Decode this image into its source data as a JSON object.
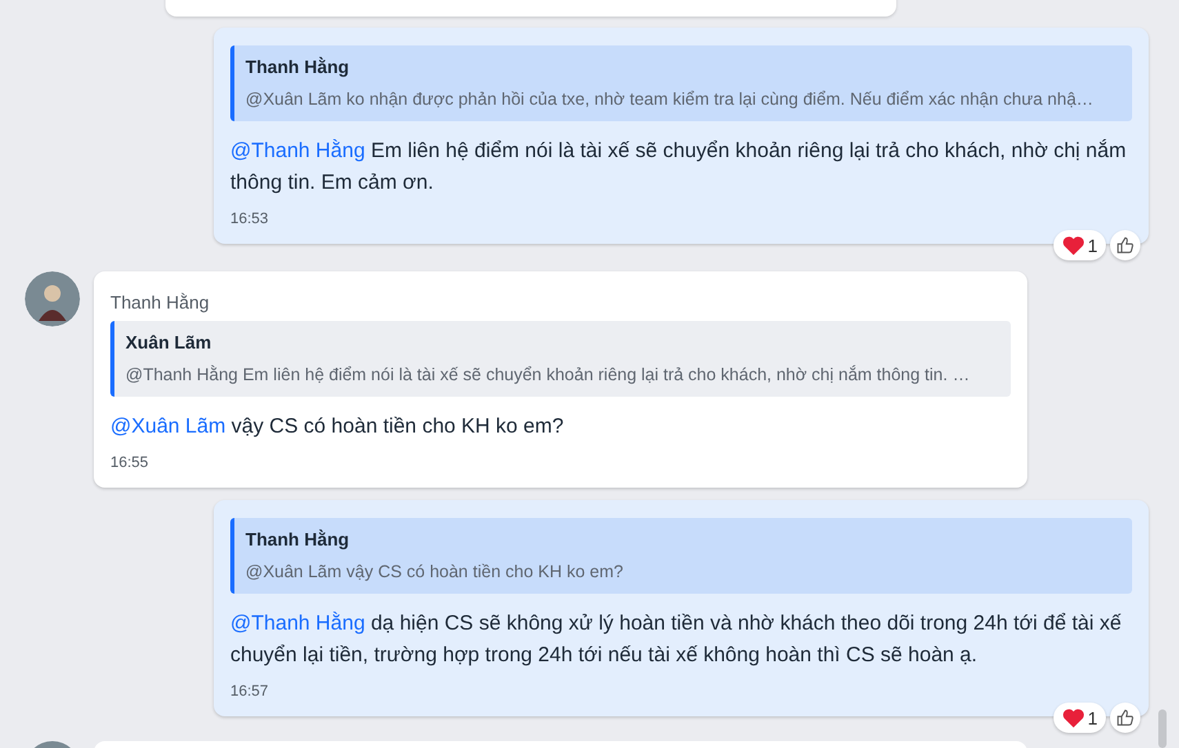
{
  "messages": [
    {
      "kind": "sent",
      "quote": {
        "author": "Thanh Hằng",
        "text": "@Xuân Lãm ko nhận được phản hồi của txe, nhờ team kiểm tra lại cùng điểm. Nếu điểm xác nhận chưa nhậ…"
      },
      "mention": "@Thanh Hằng",
      "body": "Em liên hệ điểm nói là tài xế sẽ chuyển khoản riêng lại trả cho khách, nhờ chị nắm thông tin. Em cảm ơn.",
      "time": "16:53",
      "reaction_count": "1"
    },
    {
      "kind": "received",
      "sender": "Thanh Hằng",
      "quote": {
        "author": "Xuân Lãm",
        "text": "@Thanh Hằng Em liên hệ điểm nói là tài xế sẽ chuyển khoản riêng lại trả cho khách, nhờ chị nắm thông tin. …"
      },
      "mention": "@Xuân Lãm",
      "body": "vậy CS có hoàn tiền cho KH ko em?",
      "time": "16:55"
    },
    {
      "kind": "sent",
      "quote": {
        "author": "Thanh Hằng",
        "text": "@Xuân Lãm vậy CS có hoàn tiền cho KH ko em?"
      },
      "mention": "@Thanh Hằng",
      "body": "dạ hiện CS sẽ không xử lý hoàn tiền và nhờ khách theo dõi trong 24h tới để tài xế chuyển lại tiền, trường hợp trong 24h tới nếu tài xế không hoàn thì CS sẽ hoàn ạ.",
      "time": "16:57",
      "reaction_count": "1"
    }
  ]
}
